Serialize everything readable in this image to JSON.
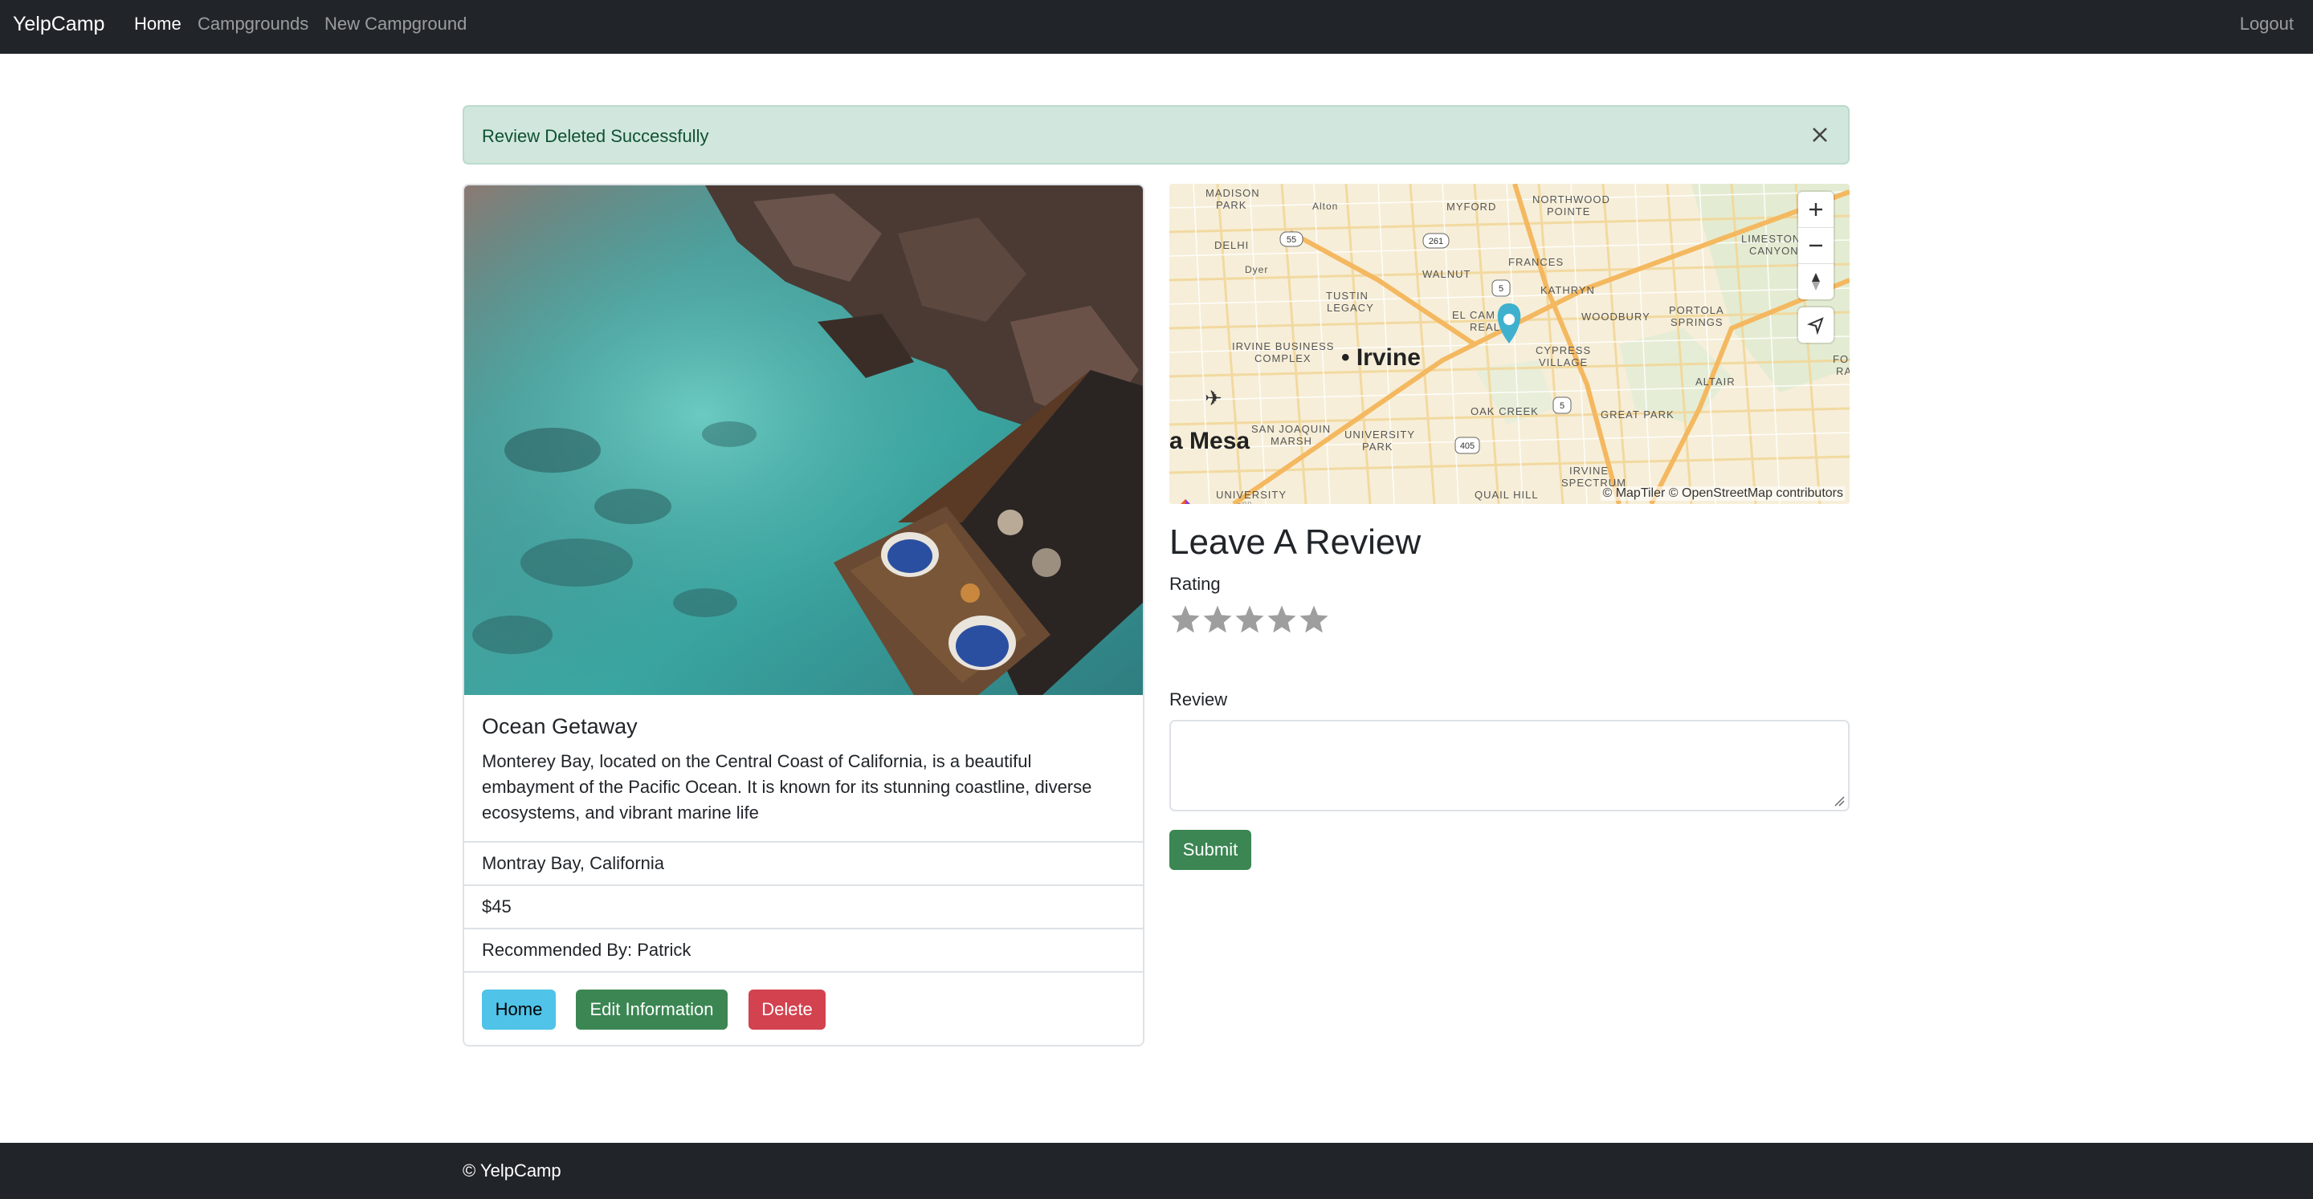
{
  "navbar": {
    "brand": "YelpCamp",
    "links": [
      {
        "label": "Home",
        "active": true
      },
      {
        "label": "Campgrounds",
        "active": false
      },
      {
        "label": "New Campground",
        "active": false
      }
    ],
    "logout_label": "Logout"
  },
  "alert": {
    "message": "Review Deleted Successfully",
    "close_icon": "close-icon"
  },
  "campground": {
    "title": "Ocean Getaway",
    "description": "Monterey Bay, located on the Central Coast of California, is a beautiful embayment of the Pacific Ocean. It is known for its stunning coastline, diverse ecosystems, and vibrant marine life",
    "location": "Montray Bay, California",
    "price": "$45",
    "recommended_by": "Recommended By: Patrick",
    "buttons": {
      "home": "Home",
      "edit": "Edit Information",
      "delete": "Delete"
    }
  },
  "map": {
    "labels": {
      "irvine": "Irvine",
      "costa_mesa": "a Mesa",
      "madison_park": "MADISON\nPARK",
      "northwood": "NORTHWOOD\nPOINTE",
      "myford": "MYFORD",
      "limestone": "LIMESTONE\nCANYON",
      "walnut": "WALNUT",
      "frances": "FRANCES",
      "kathryn": "KATHRYN",
      "tustin_legacy": "TUSTIN\nLEGACY",
      "el_camino": "EL CAMINO\nREAL",
      "woodbury": "WOODBURY",
      "portola": "PORTOLA\nSPRINGS",
      "irvine_business": "IRVINE BUSINESS\nCOMPLEX",
      "cypress": "CYPRESS\nVILLAGE",
      "altair": "ALTAIR",
      "oak_creek": "OAK CREEK",
      "great_park": "GREAT PARK",
      "san_joaquin": "SAN JOAQUIN\nMARSH",
      "university_park": "UNIVERSITY\nPARK",
      "irvine_spectrum": "IRVINE\nSPECTRUM",
      "quail_hill": "QUAIL HILL",
      "university": "UNIVERSITY",
      "delhi": "DELHI",
      "dyer": "Dyer",
      "alton": "Alton",
      "foo": "FOO\nRA"
    },
    "shields": [
      "55",
      "261",
      "5",
      "5",
      "405"
    ],
    "attribution": "© MapTiler © OpenStreetMap contributors",
    "logo_text": "maptiler",
    "controls": [
      "zoom-in-icon",
      "zoom-out-icon",
      "compass-icon",
      "geolocate-icon"
    ]
  },
  "review_form": {
    "heading": "Leave A Review",
    "rating_label": "Rating",
    "star_count": 5,
    "review_label": "Review",
    "submit_label": "Submit"
  },
  "footer": {
    "text": "© YelpCamp"
  },
  "colors": {
    "navbar_bg": "#212529",
    "alert_bg": "#d1e7dd",
    "success": "#3b8653",
    "info": "#4fc3e8",
    "danger": "#d3424f",
    "star": "#9e9e9e",
    "map_marker": "#3fb1ce"
  }
}
